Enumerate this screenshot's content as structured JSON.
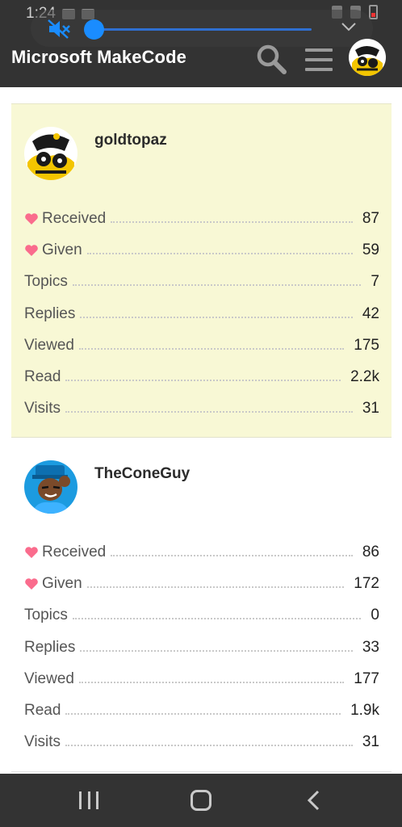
{
  "status_bar": {
    "time": "1:24"
  },
  "header": {
    "title": "Microsoft MakeCode"
  },
  "users": [
    {
      "username": "goldtopaz",
      "stats": [
        {
          "label": "Received",
          "value": "87",
          "heart": true
        },
        {
          "label": "Given",
          "value": "59",
          "heart": true
        },
        {
          "label": "Topics",
          "value": "7",
          "heart": false
        },
        {
          "label": "Replies",
          "value": "42",
          "heart": false
        },
        {
          "label": "Viewed",
          "value": "175",
          "heart": false
        },
        {
          "label": "Read",
          "value": "2.2k",
          "heart": false
        },
        {
          "label": "Visits",
          "value": "31",
          "heart": false
        }
      ]
    },
    {
      "username": "TheConeGuy",
      "stats": [
        {
          "label": "Received",
          "value": "86",
          "heart": true
        },
        {
          "label": "Given",
          "value": "172",
          "heart": true
        },
        {
          "label": "Topics",
          "value": "0",
          "heart": false
        },
        {
          "label": "Replies",
          "value": "33",
          "heart": false
        },
        {
          "label": "Viewed",
          "value": "177",
          "heart": false
        },
        {
          "label": "Read",
          "value": "1.9k",
          "heart": false
        },
        {
          "label": "Visits",
          "value": "31",
          "heart": false
        }
      ]
    }
  ],
  "icons": {
    "heart": "heart-icon",
    "search": "search-icon",
    "menu": "hamburger-menu-icon",
    "mute": "volume-mute-icon"
  },
  "colors": {
    "header_bg": "#333333",
    "highlight_card_bg": "#f8f8d5",
    "heart": "#fa6c8d",
    "volume_accent": "#1a8cff"
  }
}
